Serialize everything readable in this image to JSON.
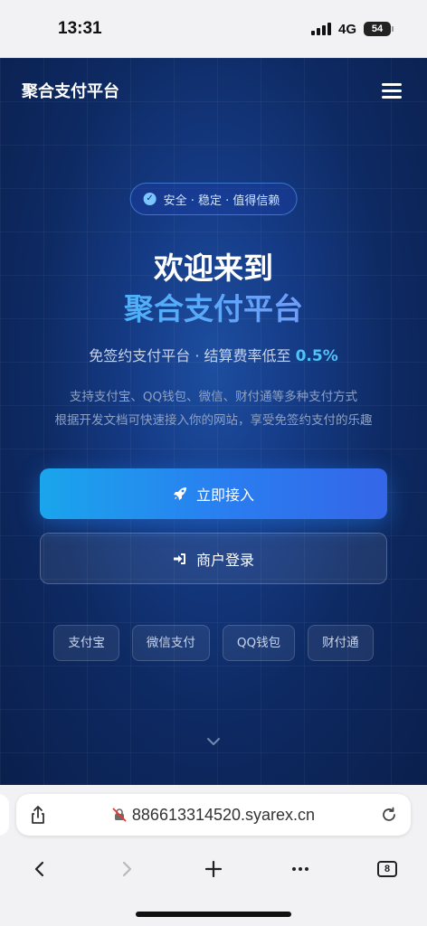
{
  "status_bar": {
    "time": "13:31",
    "network": "4G",
    "battery": "54"
  },
  "nav": {
    "brand": "聚合支付平台"
  },
  "hero": {
    "badge": "安全 · 稳定 · 值得信赖",
    "title_line1": "欢迎来到",
    "title_line2": "聚合支付平台",
    "subline_prefix": "免签约支付平台  ·  结算费率低至 ",
    "rate": "0.5%",
    "desc_line1": "支持支付宝、QQ钱包、微信、财付通等多种支付方式",
    "desc_line2": "根据开发文档可快速接入你的网站，享受免签约支付的乐趣"
  },
  "buttons": {
    "primary": "立即接入",
    "secondary": "商户登录"
  },
  "payment_methods": [
    "支付宝",
    "微信支付",
    "QQ钱包",
    "财付通"
  ],
  "safari": {
    "url": "886613314520.syarex.cn",
    "tab_count": "8"
  },
  "colors": {
    "accent": "#2a7df0",
    "rate": "#4fc3f7",
    "page_bg": "#0e2a63"
  }
}
